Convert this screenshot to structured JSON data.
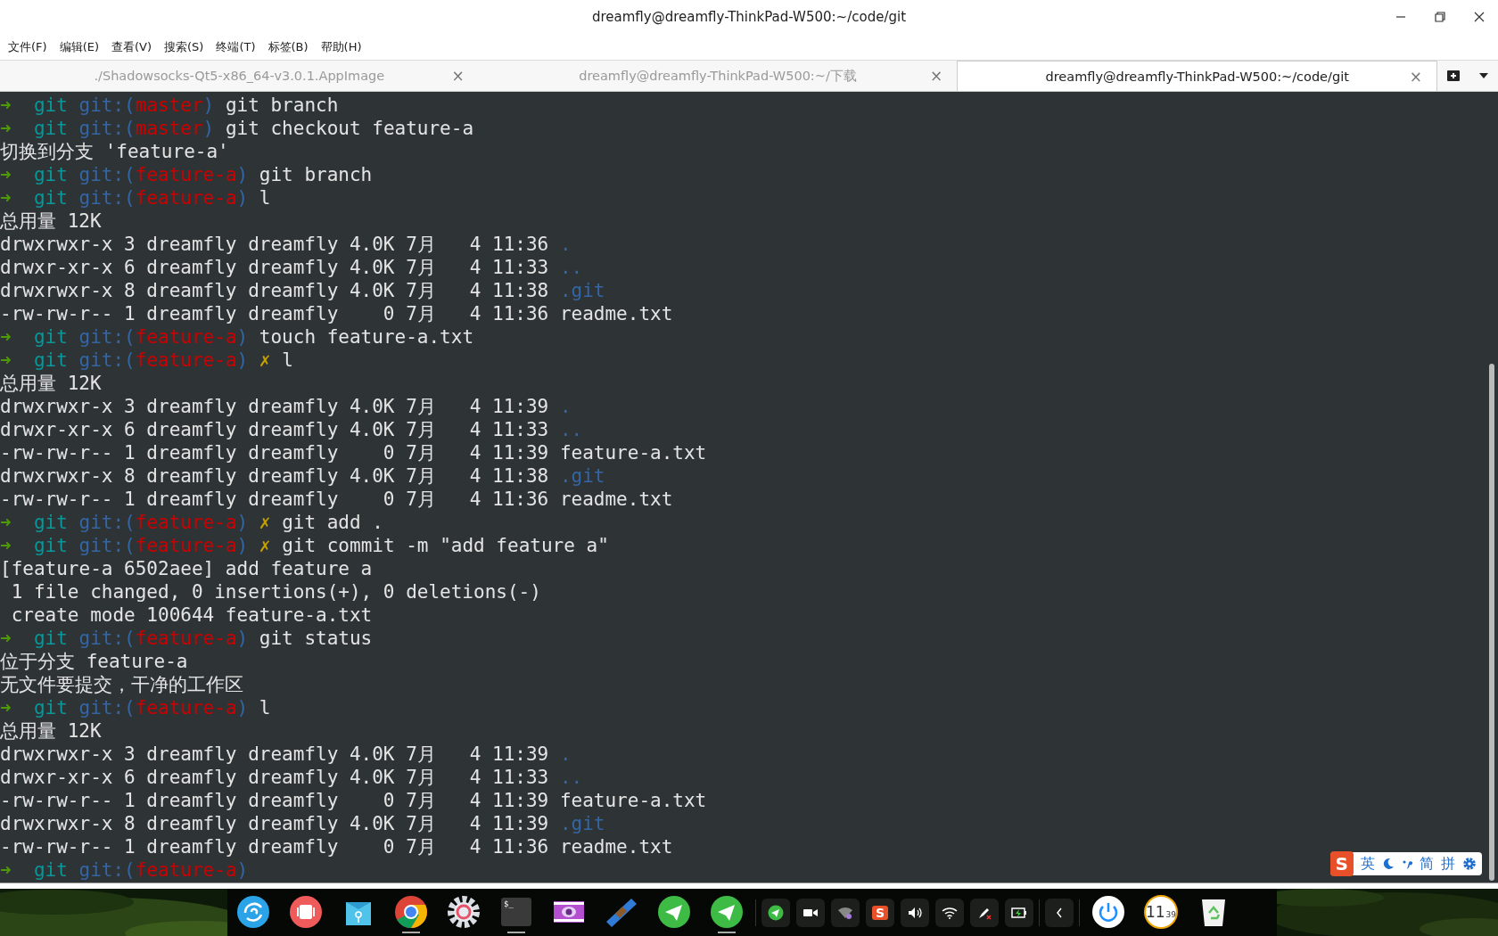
{
  "window": {
    "title": "dreamfly@dreamfly-ThinkPad-W500:~/code/git"
  },
  "menu": [
    "文件(F)",
    "编辑(E)",
    "查看(V)",
    "搜索(S)",
    "终端(T)",
    "标签(B)",
    "帮助(H)"
  ],
  "tabs": [
    {
      "label": "./Shadowsocks-Qt5-x86_64-v3.0.1.AppImage",
      "close": "×",
      "selected": false
    },
    {
      "label": "dreamfly@dreamfly-ThinkPad-W500:~/下载",
      "close": "×",
      "selected": false
    },
    {
      "label": "dreamfly@dreamfly-ThinkPad-W500:~/code/git",
      "close": "×",
      "selected": true
    }
  ],
  "terminal": {
    "lines": [
      {
        "kind": "prompt",
        "arrow": "➜",
        "dir": "git",
        "vcs_open": "git:(",
        "branch": "master",
        "vcs_close": ")",
        "command": "git branch"
      },
      {
        "kind": "prompt",
        "arrow": "➜",
        "dir": "git",
        "vcs_open": "git:(",
        "branch": "master",
        "vcs_close": ")",
        "command": "git checkout feature-a"
      },
      {
        "kind": "output",
        "text": "切换到分支 'feature-a'"
      },
      {
        "kind": "prompt",
        "arrow": "➜",
        "dir": "git",
        "vcs_open": "git:(",
        "branch": "feature-a",
        "vcs_close": ")",
        "command": "git branch"
      },
      {
        "kind": "prompt",
        "arrow": "➜",
        "dir": "git",
        "vcs_open": "git:(",
        "branch": "feature-a",
        "vcs_close": ")",
        "command": "l"
      },
      {
        "kind": "output",
        "text": "总用量 12K"
      },
      {
        "kind": "listing",
        "info": "drwxrwxr-x 3 dreamfly dreamfly 4.0K 7月   4 11:36",
        "name": ".",
        "directory": true
      },
      {
        "kind": "listing",
        "info": "drwxr-xr-x 6 dreamfly dreamfly 4.0K 7月   4 11:33",
        "name": "..",
        "directory": true
      },
      {
        "kind": "listing",
        "info": "drwxrwxr-x 8 dreamfly dreamfly 4.0K 7月   4 11:38",
        "name": ".git",
        "directory": true
      },
      {
        "kind": "listing",
        "info": "-rw-rw-r-- 1 dreamfly dreamfly    0 7月   4 11:36",
        "name": "readme.txt",
        "directory": false
      },
      {
        "kind": "prompt",
        "arrow": "➜",
        "dir": "git",
        "vcs_open": "git:(",
        "branch": "feature-a",
        "vcs_close": ")",
        "command": "touch feature-a.txt"
      },
      {
        "kind": "prompt",
        "arrow": "➜",
        "dir": "git",
        "vcs_open": "git:(",
        "branch": "feature-a",
        "vcs_close": ")",
        "mark": "✗",
        "command": "l"
      },
      {
        "kind": "output",
        "text": "总用量 12K"
      },
      {
        "kind": "listing",
        "info": "drwxrwxr-x 3 dreamfly dreamfly 4.0K 7月   4 11:39",
        "name": ".",
        "directory": true
      },
      {
        "kind": "listing",
        "info": "drwxr-xr-x 6 dreamfly dreamfly 4.0K 7月   4 11:33",
        "name": "..",
        "directory": true
      },
      {
        "kind": "listing",
        "info": "-rw-rw-r-- 1 dreamfly dreamfly    0 7月   4 11:39",
        "name": "feature-a.txt",
        "directory": false
      },
      {
        "kind": "listing",
        "info": "drwxrwxr-x 8 dreamfly dreamfly 4.0K 7月   4 11:38",
        "name": ".git",
        "directory": true
      },
      {
        "kind": "listing",
        "info": "-rw-rw-r-- 1 dreamfly dreamfly    0 7月   4 11:36",
        "name": "readme.txt",
        "directory": false
      },
      {
        "kind": "prompt",
        "arrow": "➜",
        "dir": "git",
        "vcs_open": "git:(",
        "branch": "feature-a",
        "vcs_close": ")",
        "mark": "✗",
        "command": "git add ."
      },
      {
        "kind": "prompt",
        "arrow": "➜",
        "dir": "git",
        "vcs_open": "git:(",
        "branch": "feature-a",
        "vcs_close": ")",
        "mark": "✗",
        "command": "git commit -m \"add feature a\""
      },
      {
        "kind": "output",
        "text": "[feature-a 6502aee] add feature a"
      },
      {
        "kind": "output",
        "text": " 1 file changed, 0 insertions(+), 0 deletions(-)"
      },
      {
        "kind": "output",
        "text": " create mode 100644 feature-a.txt"
      },
      {
        "kind": "prompt",
        "arrow": "➜",
        "dir": "git",
        "vcs_open": "git:(",
        "branch": "feature-a",
        "vcs_close": ")",
        "command": "git status"
      },
      {
        "kind": "output",
        "text": "位于分支 feature-a"
      },
      {
        "kind": "output",
        "text": "无文件要提交，干净的工作区"
      },
      {
        "kind": "prompt",
        "arrow": "➜",
        "dir": "git",
        "vcs_open": "git:(",
        "branch": "feature-a",
        "vcs_close": ")",
        "command": "l"
      },
      {
        "kind": "output",
        "text": "总用量 12K"
      },
      {
        "kind": "listing",
        "info": "drwxrwxr-x 3 dreamfly dreamfly 4.0K 7月   4 11:39",
        "name": ".",
        "directory": true
      },
      {
        "kind": "listing",
        "info": "drwxr-xr-x 6 dreamfly dreamfly 4.0K 7月   4 11:33",
        "name": "..",
        "directory": true
      },
      {
        "kind": "listing",
        "info": "-rw-rw-r-- 1 dreamfly dreamfly    0 7月   4 11:39",
        "name": "feature-a.txt",
        "directory": false
      },
      {
        "kind": "listing",
        "info": "drwxrwxr-x 8 dreamfly dreamfly 4.0K 7月   4 11:39",
        "name": ".git",
        "directory": true
      },
      {
        "kind": "listing",
        "info": "-rw-rw-r-- 1 dreamfly dreamfly    0 7月   4 11:36",
        "name": "readme.txt",
        "directory": false
      },
      {
        "kind": "prompt",
        "arrow": "➜",
        "dir": "git",
        "vcs_open": "git:(",
        "branch": "feature-a",
        "vcs_close": ")"
      }
    ]
  },
  "ime": {
    "logo": "S",
    "mode": "英",
    "script": "简",
    "input": "拼"
  },
  "dock": {
    "apps": [
      {
        "kind": "launcher",
        "running": false
      },
      {
        "kind": "slides",
        "running": false
      },
      {
        "kind": "store",
        "running": false
      },
      {
        "kind": "browser",
        "running": true
      },
      {
        "kind": "settings",
        "running": false
      },
      {
        "kind": "terminal",
        "label": "$_",
        "running": true
      },
      {
        "kind": "video",
        "running": false
      },
      {
        "kind": "film",
        "running": false
      },
      {
        "kind": "plane",
        "running": false
      },
      {
        "kind": "plane",
        "running": true
      }
    ],
    "tray": [
      {
        "kind": "plane"
      },
      {
        "kind": "camera"
      },
      {
        "kind": "vpn"
      },
      {
        "kind": "sogou",
        "label": "S"
      },
      {
        "kind": "volume"
      },
      {
        "kind": "wifi"
      },
      {
        "kind": "pen"
      },
      {
        "kind": "battery"
      }
    ],
    "clock": {
      "hour": "11",
      "minute": "39"
    }
  }
}
